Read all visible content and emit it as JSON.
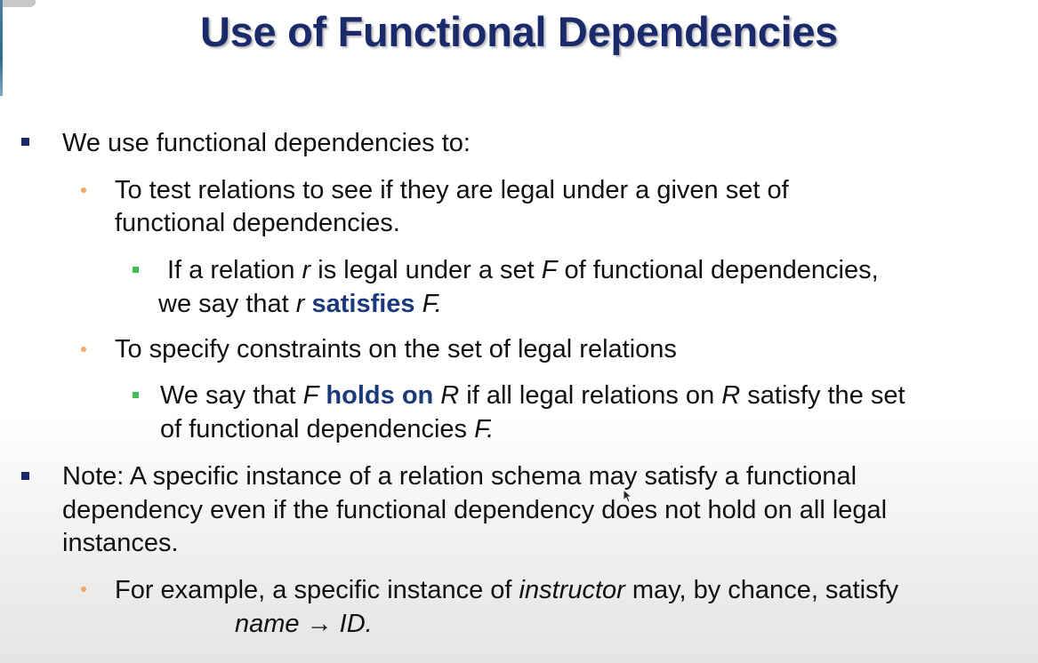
{
  "slide": {
    "title": "Use of Functional Dependencies",
    "bullet1": {
      "text": "We use functional dependencies to:"
    },
    "sub1": {
      "line1": "To test relations to see if they are legal under a given set of",
      "line2": "functional dependencies."
    },
    "sub1a": {
      "part1": "If a relation ",
      "r1": "r",
      "part2": " is legal under a set ",
      "F1": "F",
      "part3": " of functional dependencies,",
      "line2_part1": "we say that ",
      "r2": "r",
      "satisfies": " satisfies",
      "F2": " F."
    },
    "sub2": {
      "text": "To specify constraints on the set of legal relations"
    },
    "sub2a": {
      "part1": "We say that ",
      "F1": "F",
      "holds_on": " holds on",
      "R1": " R",
      "part2": " if all legal relations on ",
      "R2": "R",
      "part3": " satisfy the set",
      "line2_part1": "of functional dependencies ",
      "F2": "F."
    },
    "bullet2": {
      "line1": "Note:  A specific instance of a relation schema may satisfy a functional",
      "line2": "dependency even if the functional dependency does not hold on all legal",
      "line3": "instances."
    },
    "sub3": {
      "part1": "For example, a specific instance of ",
      "instructor": "instructor",
      "part2": " may, by chance, satisfy",
      "fd_line": "name → ID."
    }
  },
  "colors": {
    "title": "#1b2a6b",
    "square_bullet": "#1b2a6b",
    "dot_bullet": "#f0a868",
    "green_bullet": "#3fbf55",
    "emphasis": "#1b3a7a"
  },
  "icons": {
    "cursor": "mouse-pointer-icon"
  }
}
